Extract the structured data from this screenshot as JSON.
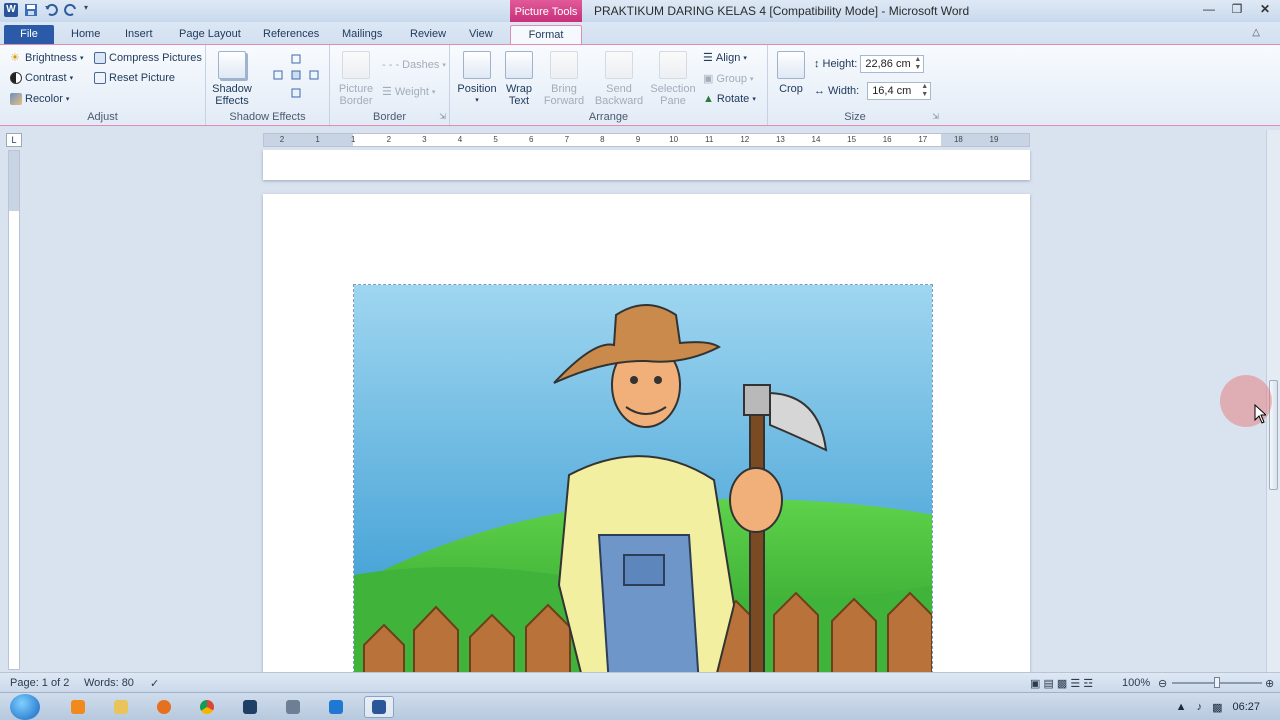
{
  "window": {
    "app_logo": "W",
    "title": "PRAKTIKUM DARING KELAS 4 [Compatibility Mode] - Microsoft Word",
    "context_tab_group": "Picture Tools",
    "controls": [
      "minimize-icon",
      "restore-icon",
      "close-icon"
    ]
  },
  "tabs": [
    {
      "label": "File"
    },
    {
      "label": "Home"
    },
    {
      "label": "Insert"
    },
    {
      "label": "Page Layout"
    },
    {
      "label": "References"
    },
    {
      "label": "Mailings"
    },
    {
      "label": "Review"
    },
    {
      "label": "View"
    },
    {
      "label": "Format"
    }
  ],
  "ribbon": {
    "adjust": {
      "label": "Adjust",
      "brightness": "Brightness",
      "contrast": "Contrast",
      "recolor": "Recolor",
      "compress": "Compress Pictures",
      "reset": "Reset Picture"
    },
    "shadow": {
      "label": "Shadow Effects",
      "button": "Shadow Effects",
      "button_line1": "Shadow",
      "button_line2": "Effects"
    },
    "border": {
      "label": "Border",
      "picture_border_line1": "Picture",
      "picture_border_line2": "Border",
      "dashes": "Dashes",
      "weight": "Weight"
    },
    "arrange": {
      "label": "Arrange",
      "position": "Position",
      "wrap_line1": "Wrap",
      "wrap_line2": "Text",
      "bring_line1": "Bring",
      "bring_line2": "Forward",
      "send_line1": "Send",
      "send_line2": "Backward",
      "selection_line1": "Selection",
      "selection_line2": "Pane",
      "align": "Align",
      "group": "Group",
      "rotate": "Rotate"
    },
    "size": {
      "label": "Size",
      "crop": "Crop",
      "height_label": "Height:",
      "height_value": "22,86 cm",
      "width_label": "Width:",
      "width_value": "16,4 cm"
    }
  },
  "ruler": {
    "corner": "L",
    "ticks": [
      "2",
      "1",
      "1",
      "2",
      "3",
      "4",
      "5",
      "6",
      "7",
      "8",
      "9",
      "10",
      "11",
      "12",
      "13",
      "14",
      "15",
      "16",
      "17",
      "18",
      "19"
    ]
  },
  "statusbar": {
    "page": "Page: 1 of 2",
    "words": "Words: 80",
    "zoom": "100%",
    "zoom_fraction": 0.5
  },
  "taskbar": {
    "time": "06:27"
  },
  "colors": {
    "context_tab": "#d23f86",
    "file_tab": "#2a5aa8",
    "ribbon_bg": "#e2ebf6",
    "workspace_bg": "#d9e2ef"
  }
}
